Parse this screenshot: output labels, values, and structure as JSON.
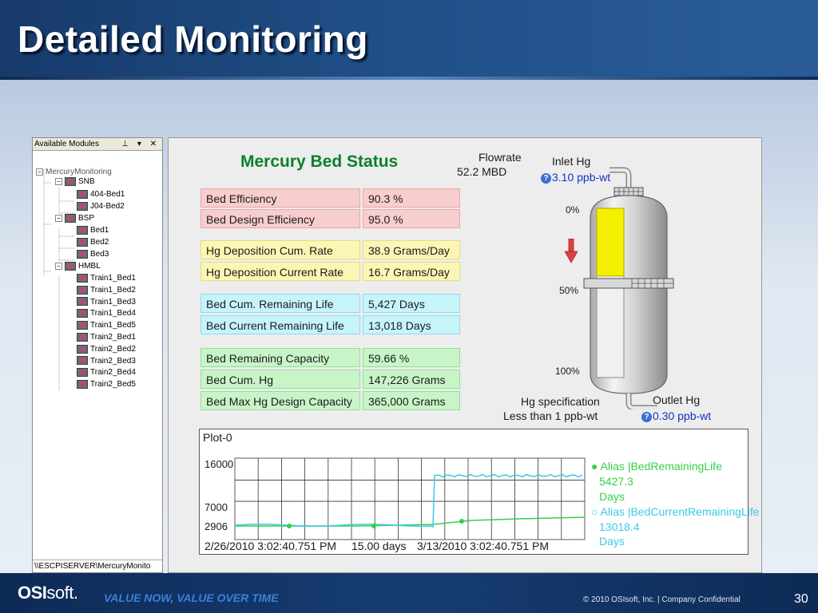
{
  "slide": {
    "title": "Detailed Monitoring",
    "footer_logo_bold": "OSI",
    "footer_logo_thin": "soft",
    "footer_logo_mark": ".",
    "tagline": "VALUE NOW, VALUE OVER TIME",
    "copyright": "© 2010 OSIsoft, Inc.  |  Company Confidential",
    "page_number": "30"
  },
  "tree": {
    "header": "Available Modules",
    "controls": "⊥ ▾ ✕",
    "root": "MercuryMonitoring",
    "icon_letter": "M",
    "group1": "SNB",
    "group1_items": [
      "404-Bed1",
      "J04-Bed2"
    ],
    "group2": "BSP",
    "group2_items": [
      "Bed1",
      "Bed2",
      "Bed3"
    ],
    "group3": "HMBL",
    "group3_items": [
      "Train1_Bed1",
      "Train1_Bed2",
      "Train1_Bed3",
      "Train1_Bed4",
      "Train1_Bed5",
      "Train2_Bed1",
      "Train2_Bed2",
      "Train2_Bed3",
      "Train2_Bed4",
      "Train2_Bed5"
    ],
    "path": "\\\\ESCPISERVER\\MercuryMonito"
  },
  "status": {
    "title": "Mercury Bed Status",
    "rows": {
      "bed_efficiency_label": "Bed Efficiency",
      "bed_efficiency_value": "90.3 %",
      "bed_design_eff_label": "Bed Design Efficiency",
      "bed_design_eff_value": "95.0 %",
      "hg_dep_cum_label": "Hg Deposition Cum. Rate",
      "hg_dep_cum_value": "38.9 Grams/Day",
      "hg_dep_cur_label": "Hg Deposition Current Rate",
      "hg_dep_cur_value": "16.7 Grams/Day",
      "bed_cum_life_label": "Bed Cum. Remaining Life",
      "bed_cum_life_value": "5,427 Days",
      "bed_cur_life_label": "Bed Current Remaining Life",
      "bed_cur_life_value": "13,018 Days",
      "bed_rem_cap_label": "Bed Remaining Capacity",
      "bed_rem_cap_value": "59.66 %",
      "bed_cum_hg_label": "Bed Cum. Hg",
      "bed_cum_hg_value": "147,226 Grams",
      "bed_max_hg_label": "Bed Max Hg Design Capacity",
      "bed_max_hg_value": "365,000 Grams"
    }
  },
  "vessel": {
    "flowrate_label": "Flowrate",
    "flowrate_value": "52.2 MBD",
    "inlet_label": "Inlet Hg",
    "inlet_value": "3.10 ppb-wt",
    "outlet_label": "Outlet Hg",
    "outlet_value": "0.30 ppb-wt",
    "spec_label": "Hg specification",
    "spec_value": "Less than 1 ppb-wt",
    "scale_0": "0%",
    "scale_50": "50%",
    "scale_100": "100%",
    "help_glyph": "?",
    "fill_fraction": 0.4
  },
  "colors": {
    "title_green": "#0c7f2c",
    "value_blue": "#1432c8",
    "series_1": "#35d04a",
    "series_2": "#3cc8e8",
    "fill_yellow": "#f5f000",
    "arrow_red": "#e04040"
  },
  "plot": {
    "title": "Plot-0",
    "start_time": "2/26/2010 3:02:40.751 PM",
    "span": "15.00 days",
    "end_time": "3/13/2010 3:02:40.751 PM",
    "y_ticks": [
      "16000",
      "7000",
      "2906"
    ],
    "legend1_name": "Alias |BedRemainingLife",
    "legend1_value": "5427.3",
    "legend1_unit": "Days",
    "legend2_name": "Alias |BedCurrentRemainingLife",
    "legend2_value": "13018.4",
    "legend2_unit": "Days"
  }
}
